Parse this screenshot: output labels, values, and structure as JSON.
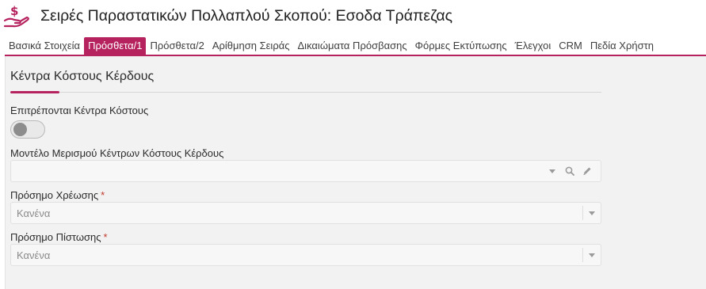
{
  "window": {
    "title": "Σειρές Παραστατικών Πολλαπλού Σκοπού: Εσοδα Τράπεζας"
  },
  "colors": {
    "accent": "#b5225e",
    "panel_bg": "#f2f2f2",
    "required_star": "#c0392b"
  },
  "tabs": [
    {
      "label": "Βασικά Στοιχεία",
      "active": false
    },
    {
      "label": "Πρόσθετα/1",
      "active": true
    },
    {
      "label": "Πρόσθετα/2",
      "active": false
    },
    {
      "label": "Αρίθμηση Σειράς",
      "active": false
    },
    {
      "label": "Δικαιώματα Πρόσβασης",
      "active": false
    },
    {
      "label": "Φόρμες Εκτύπωσης",
      "active": false
    },
    {
      "label": "Έλεγχοι",
      "active": false
    },
    {
      "label": "CRM",
      "active": false
    },
    {
      "label": "Πεδία Χρήστη",
      "active": false
    }
  ],
  "section": {
    "title": "Κέντρα Κόστους Κέρδους"
  },
  "fields": {
    "allow_cost_centers": {
      "label": "Επιτρέπονται Κέντρα Κόστους",
      "toggle_on": false
    },
    "allocation_model": {
      "label": "Μοντέλο Μερισμού Κέντρων Κόστους Κέρδους",
      "value": "",
      "icons": [
        "chevron-down-icon",
        "search-icon",
        "pencil-icon"
      ]
    },
    "debit_sign": {
      "label": "Πρόσημο Χρέωσης",
      "required": "*",
      "value": "Κανένα"
    },
    "credit_sign": {
      "label": "Πρόσημο Πίστωσης",
      "required": "*",
      "value": "Κανένα"
    }
  }
}
